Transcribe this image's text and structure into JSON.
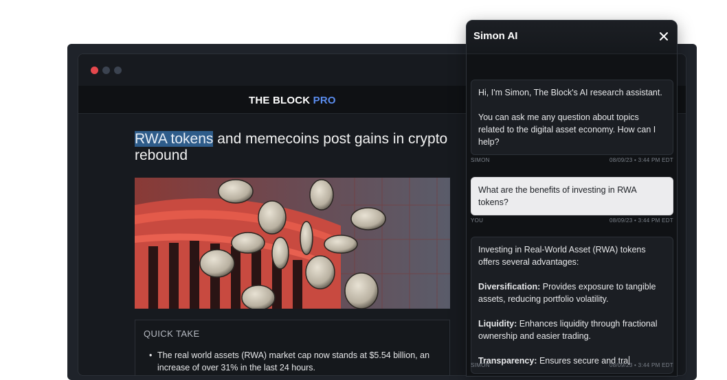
{
  "site": {
    "logo_main": "THE BLOCK",
    "logo_pro": "PRO"
  },
  "article": {
    "headline_highlight": "RWA tokens",
    "headline_rest": " and memecoins post gains in crypto rebound",
    "quick_take_title": "QUICK TAKE",
    "quick_take_bullet": "The real world assets (RWA) market cap now stands at $5.54 billion, an increase of over 31% in the last 24 hours."
  },
  "panel": {
    "title": "Simon AI",
    "messages": [
      {
        "lines": [
          "Hi, I'm Simon, The Block's AI research assistant.",
          "You can ask me any question about topics related to the digital asset economy. How can I help?"
        ],
        "sender": "SIMON",
        "timestamp": "08/09/23 • 3:44 PM EDT"
      },
      {
        "text": "What are the benefits of investing in RWA tokens?",
        "sender": "YOU",
        "timestamp": "08/09/23 • 3:44 PM EDT"
      },
      {
        "intro": "Investing in Real-World Asset (RWA) tokens offers several advantages:",
        "points": [
          {
            "label": "Diversification:",
            "text": " Provides exposure to tangible assets, reducing portfolio volatility."
          },
          {
            "label": "Liquidity:",
            "text": " Enhances liquidity through fractional ownership and easier trading."
          },
          {
            "label": "Transparency:",
            "text": " Ensures secure and tra"
          }
        ],
        "sender": "SIMON",
        "timestamp": "08/09/23 • 3:44 PM EDT"
      }
    ]
  },
  "colors": {
    "accent": "#5b8def",
    "highlight": "#2e5c8a",
    "window_dot_red": "#e5484d"
  },
  "icons": [
    "close-icon"
  ]
}
